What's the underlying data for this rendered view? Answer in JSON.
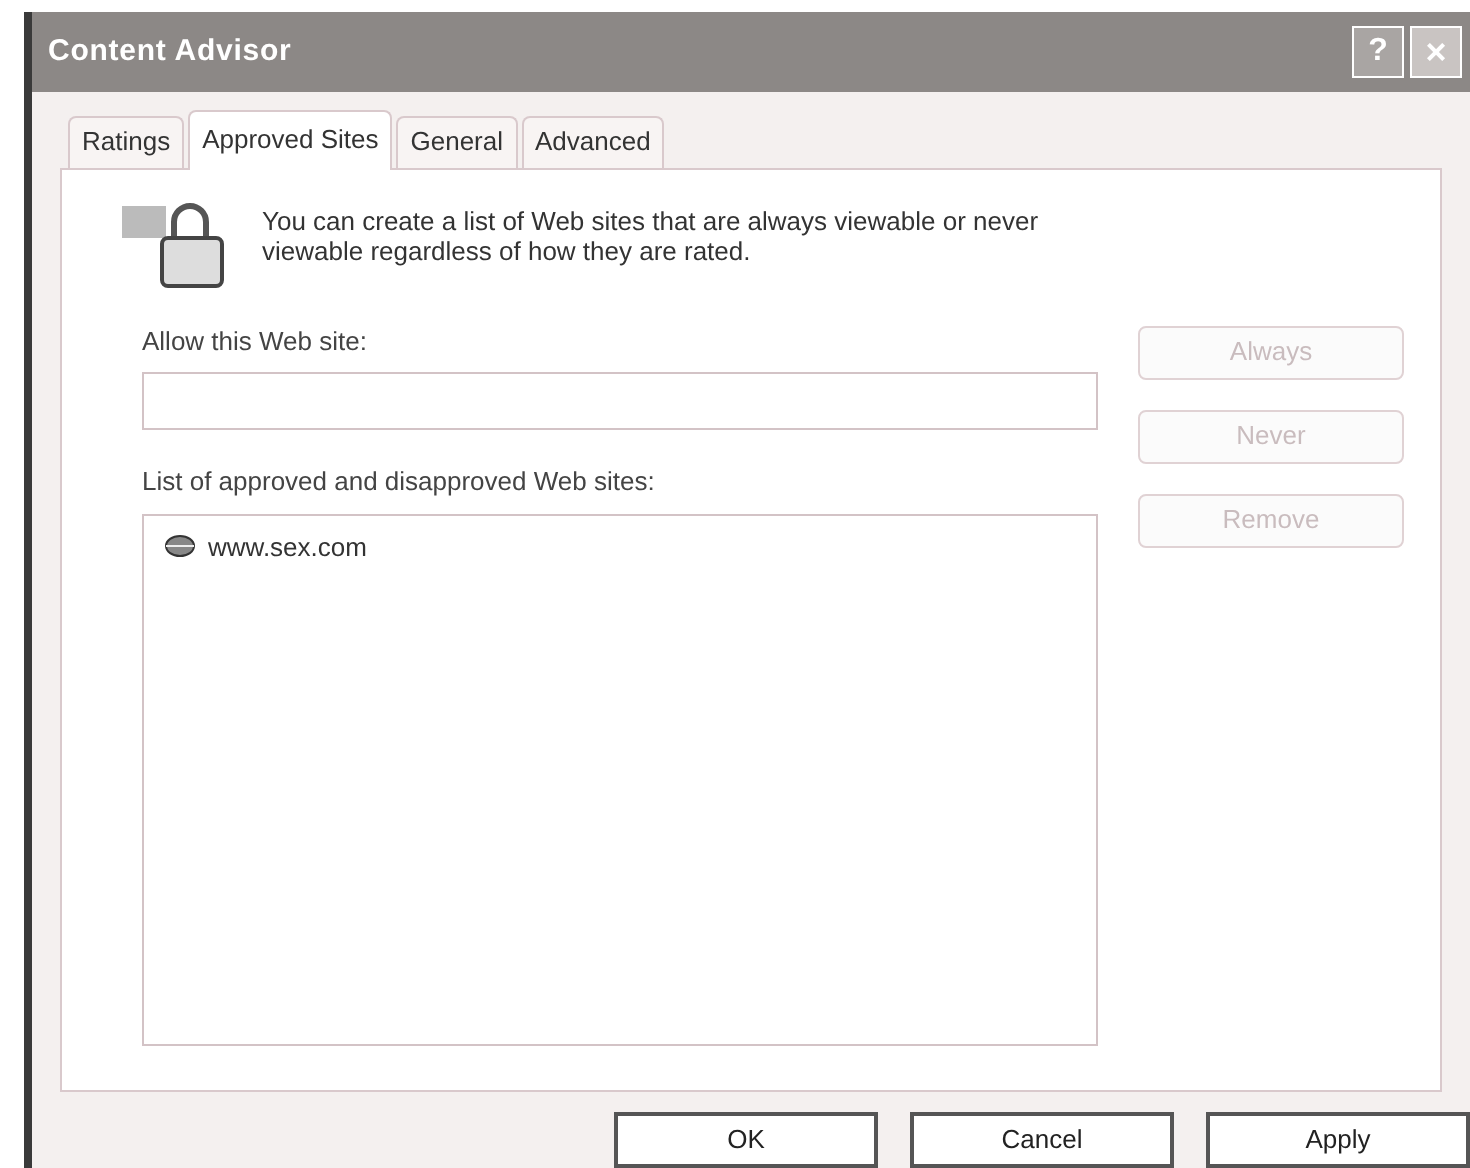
{
  "window": {
    "title": "Content Advisor",
    "help_button": "?",
    "close_button": "×"
  },
  "tabs": [
    {
      "label": "Ratings",
      "selected": false
    },
    {
      "label": "Approved Sites",
      "selected": true
    },
    {
      "label": "General",
      "selected": false
    },
    {
      "label": "Advanced",
      "selected": false
    }
  ],
  "description": "You can create a list of Web sites that are always viewable or never viewable regardless of how they are rated.",
  "site_field": {
    "label": "Allow this Web site:"
  },
  "site_list": {
    "label": "List of approved and disapproved Web sites:",
    "items": [
      {
        "text": "www.sex.com",
        "selected": false
      }
    ]
  },
  "side_buttons": [
    {
      "label": "Always",
      "disabled": true
    },
    {
      "label": "Never",
      "disabled": true
    },
    {
      "label": "Remove",
      "disabled": true
    }
  ],
  "buttons": [
    {
      "label": "OK",
      "disabled": false
    },
    {
      "label": "Cancel",
      "disabled": false
    },
    {
      "label": "Apply",
      "disabled": false
    }
  ]
}
